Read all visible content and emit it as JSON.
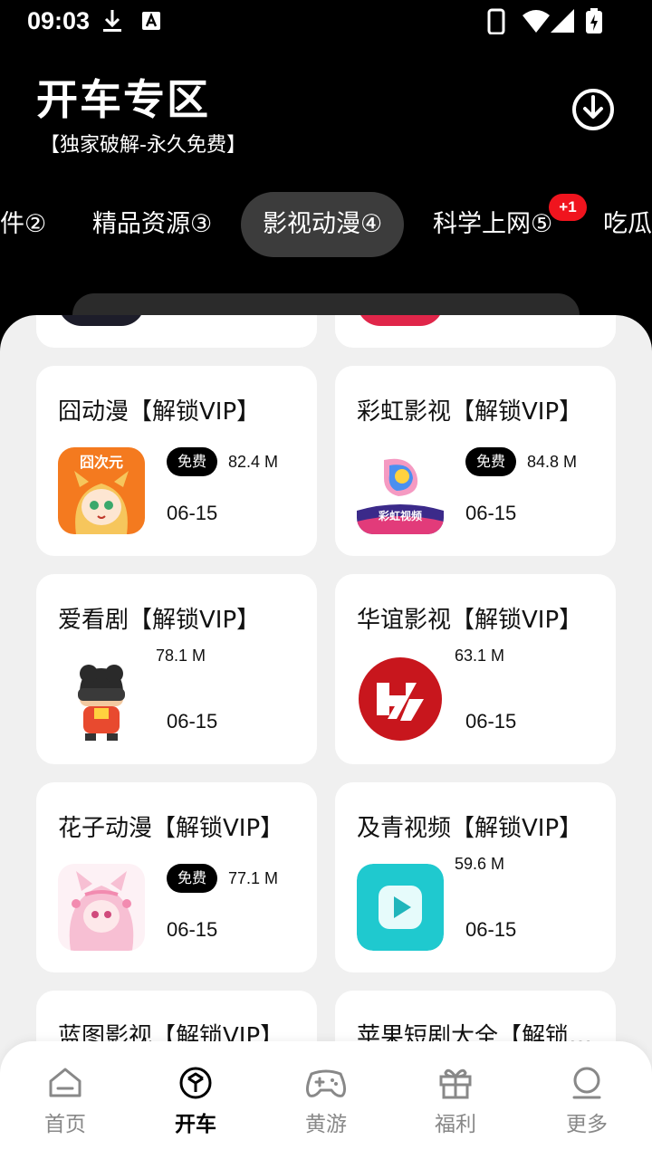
{
  "status_bar": {
    "time": "09:03"
  },
  "header": {
    "title": "开车专区",
    "subtitle": "【独家破解-永久免费】"
  },
  "tabs": [
    {
      "label": "件②"
    },
    {
      "label": "精品资源③"
    },
    {
      "label": "影视动漫④",
      "active": true
    },
    {
      "label": "科学上网⑤",
      "badge": "+1"
    },
    {
      "label": "吃瓜"
    }
  ],
  "apps": [
    {
      "name": "囧动漫【解锁VIP】",
      "free": "免费",
      "size": "82.4 M",
      "date": "06-15",
      "icon": "jiong-anime-icon"
    },
    {
      "name": "彩虹影视【解锁VIP】",
      "free": "免费",
      "size": "84.8 M",
      "date": "06-15",
      "icon": "rainbow-video-icon"
    },
    {
      "name": "爱看剧【解锁VIP】",
      "free": null,
      "size": "78.1 M",
      "date": "06-15",
      "icon": "vr-robot-icon"
    },
    {
      "name": "华谊影视【解锁VIP】",
      "free": null,
      "size": "63.1 M",
      "date": "06-15",
      "icon": "huayi-logo-icon"
    },
    {
      "name": "花子动漫【解锁VIP】",
      "free": "免费",
      "size": "77.1 M",
      "date": "06-15",
      "icon": "anime-girl-icon"
    },
    {
      "name": "及青视频【解锁VIP】",
      "free": null,
      "size": "59.6 M",
      "date": "06-15",
      "icon": "play-button-icon"
    },
    {
      "name": "蓝图影视【解锁VIP】"
    },
    {
      "name": "苹果短剧大全【解锁VIP】"
    }
  ],
  "bottom_nav": [
    {
      "label": "首页",
      "icon": "home-icon"
    },
    {
      "label": "开车",
      "icon": "cube-icon",
      "active": true
    },
    {
      "label": "黄游",
      "icon": "gamepad-icon"
    },
    {
      "label": "福利",
      "icon": "gift-icon"
    },
    {
      "label": "更多",
      "icon": "person-icon"
    }
  ],
  "colors": {
    "background": "#000000",
    "panel": "#f0f0f0",
    "badge": "#f0141e",
    "active_tab": "#3c3c3c"
  }
}
